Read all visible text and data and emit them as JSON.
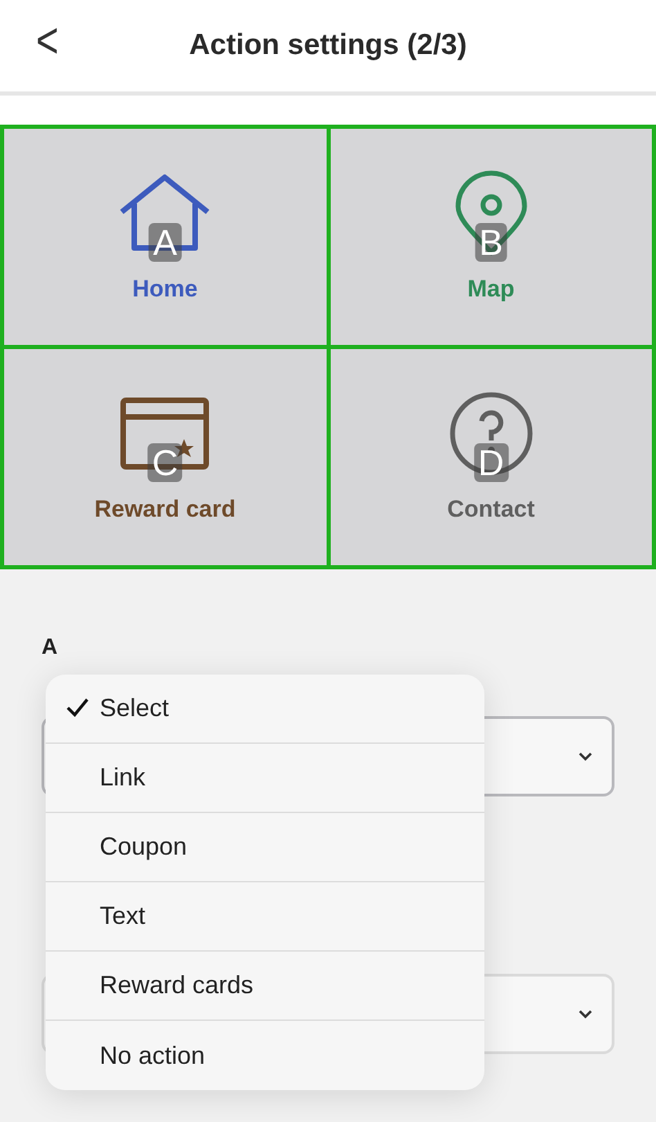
{
  "header": {
    "back": "<",
    "title": "Action settings (2/3)"
  },
  "tiles": [
    {
      "kind": "home",
      "label": "Home",
      "marker": "A",
      "color": "#3d5bbd"
    },
    {
      "kind": "pin",
      "label": "Map",
      "marker": "B",
      "color": "#2e8b57"
    },
    {
      "kind": "card",
      "label": "Reward card",
      "marker": "C",
      "color": "#6e4a2a"
    },
    {
      "kind": "help",
      "label": "Contact",
      "marker": "D",
      "color": "#5f5f5f"
    }
  ],
  "sections": [
    {
      "heading": "A",
      "kind": "select"
    },
    {
      "kind": "select"
    }
  ],
  "menu": [
    {
      "label": "Select",
      "selected": true
    },
    {
      "label": "Link",
      "selected": false
    },
    {
      "label": "Coupon",
      "selected": false
    },
    {
      "label": "Text",
      "selected": false
    },
    {
      "label": "Reward cards",
      "selected": false
    },
    {
      "label": "No action",
      "selected": false
    }
  ]
}
